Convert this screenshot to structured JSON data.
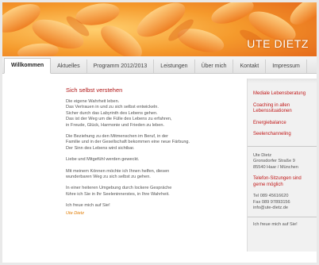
{
  "brand": {
    "name": "UTE DIETZ"
  },
  "nav": {
    "items": [
      "Willkommen",
      "Aktuelles",
      "Programm 2012/2013",
      "Leistungen",
      "Über mich",
      "Kontakt",
      "Impressum"
    ]
  },
  "main": {
    "heading": "Sich selbst verstehen",
    "paragraphs": [
      [
        "Die eigene Wahrheit leben.",
        "Das Vertrauen in und zu sich selbst entwickeln.",
        "Sicher durch das Labyrinth des Lebens gehen.",
        "Das ist der Weg um die Fülle des Lebens zu erfahren,",
        "in Freude, Glück, Harmonie und Frieden zu leben."
      ],
      [
        "Die Beziehung zu den Mitmenschen im Beruf, in der",
        "Familie und in der Gesellschaft bekommen eine neue Färbung.",
        "Der Sinn des Lebens wird sichtbar."
      ],
      [
        "Liebe und Mitgefühl werden geweckt."
      ],
      [
        "Mit meinem Können möchte ich Ihnen helfen, diesen",
        "wunderbaren Weg zu sich selbst zu gehen."
      ],
      [
        "In einer heiteren Umgebung durch lockere Gespräche",
        "führe ich Sie in Ihr Seeleninnerstes, in Ihre Wahrheit."
      ],
      [
        "Ich freue mich auf Sie!"
      ]
    ],
    "signature": "Ute Dietz"
  },
  "sidebar": {
    "links": [
      "Mediale Lebensberatung",
      "Coaching in allen Lebenssituationen",
      "Energiebalance",
      "Seelenchanneling"
    ],
    "address": [
      "Ute Dietz",
      "Gronsdorfer Straße 9",
      "85540 Haar / München"
    ],
    "sessions": "Telefon-Sitzungen sind gerne möglich",
    "phone": [
      "Tel 089 45616620",
      "Fax 089 97893156",
      "info@ute-dietz.de"
    ],
    "footer": "Ich freue mich auf Sie!"
  },
  "colors": {
    "accent": "#c11818",
    "signature": "#e07b00",
    "banner": "#f08a1c"
  }
}
